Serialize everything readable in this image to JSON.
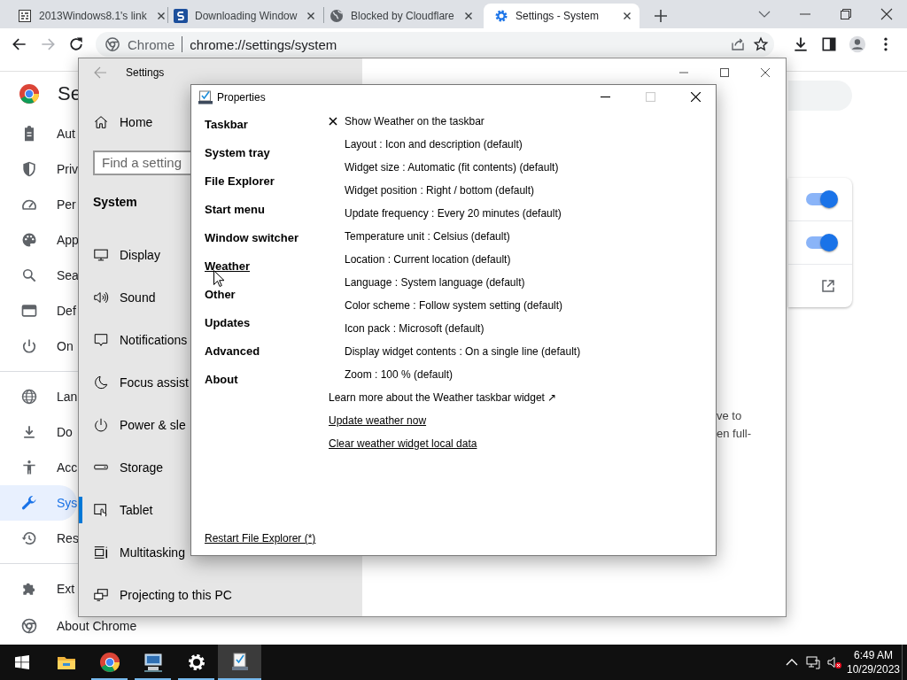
{
  "browser": {
    "tabs": [
      {
        "title": "2013Windows8.1's link",
        "selected": false
      },
      {
        "title": "Downloading Window",
        "selected": false
      },
      {
        "title": "Blocked by Cloudflare",
        "selected": false
      },
      {
        "title": "Settings - System",
        "selected": true
      }
    ],
    "address_bar": {
      "chip": "Chrome",
      "url": "chrome://settings/system"
    }
  },
  "chrome_settings": {
    "heading": "Se",
    "nav_groups": [
      [
        {
          "label": "Aut",
          "selected": false
        },
        {
          "label": "Priv",
          "selected": false
        },
        {
          "label": "Per",
          "selected": false
        },
        {
          "label": "App",
          "selected": false
        },
        {
          "label": "Sea",
          "selected": false
        },
        {
          "label": "Def",
          "selected": false
        },
        {
          "label": "On",
          "selected": false
        }
      ],
      [
        {
          "label": "Lan",
          "selected": false
        },
        {
          "label": "Do",
          "selected": false
        },
        {
          "label": "Acc",
          "selected": false
        },
        {
          "label": "Sys",
          "selected": true
        },
        {
          "label": "Res",
          "selected": false
        }
      ],
      [
        {
          "label": "Ext",
          "selected": false
        },
        {
          "label": "About Chrome",
          "selected": false
        }
      ]
    ],
    "toggles": [
      {
        "on": true
      },
      {
        "on": true
      }
    ]
  },
  "settings_window": {
    "title": "Settings",
    "home": "Home",
    "search": {
      "placeholder": "Find a setting"
    },
    "section": "System",
    "items": [
      {
        "label": "Display",
        "selected": false
      },
      {
        "label": "Sound",
        "selected": false
      },
      {
        "label": "Notifications",
        "selected": false
      },
      {
        "label": "Focus assist",
        "selected": false
      },
      {
        "label": "Power & sle",
        "selected": false
      },
      {
        "label": "Storage",
        "selected": false
      },
      {
        "label": "Tablet",
        "selected": true
      },
      {
        "label": "Multitasking",
        "selected": false
      },
      {
        "label": "Projecting to this PC",
        "selected": false
      }
    ],
    "content_lines": [
      "ve to",
      "en full-"
    ]
  },
  "properties": {
    "title": "Properties",
    "nav": [
      {
        "label": "Taskbar",
        "hovered": false
      },
      {
        "label": "System tray",
        "hovered": false
      },
      {
        "label": "File Explorer",
        "hovered": false
      },
      {
        "label": "Start menu",
        "hovered": false
      },
      {
        "label": "Window switcher",
        "hovered": false
      },
      {
        "label": "Weather",
        "hovered": true
      },
      {
        "label": "Other",
        "hovered": false
      },
      {
        "label": "Updates",
        "hovered": false
      },
      {
        "label": "Advanced",
        "hovered": false
      },
      {
        "label": "About",
        "hovered": false
      }
    ],
    "show_option": {
      "label": "Show Weather on the taskbar",
      "checked": true
    },
    "options": [
      "Layout : Icon and description (default)",
      "Widget size : Automatic (fit contents) (default)",
      "Widget position : Right / bottom (default)",
      "Update frequency : Every 20 minutes (default)",
      "Temperature unit : Celsius (default)",
      "Location : Current location (default)",
      "Language : System language (default)",
      "Color scheme : Follow system setting (default)",
      "Icon pack : Microsoft (default)",
      "Display widget contents : On a single line (default)",
      "Zoom : 100 % (default)"
    ],
    "links": [
      {
        "label": "Learn more about the Weather taskbar widget ↗",
        "underlined": false
      },
      {
        "label": "Update weather now",
        "underlined": true
      },
      {
        "label": "Clear weather widget local data",
        "underlined": true
      }
    ],
    "footer_link": "Restart File Explorer (*)"
  },
  "taskbar": {
    "apps": [
      {
        "running": false,
        "selected": false
      },
      {
        "running": true,
        "selected": false
      },
      {
        "running": true,
        "selected": false
      },
      {
        "running": true,
        "selected": false
      },
      {
        "running": true,
        "selected": true
      }
    ],
    "time": "6:49 AM",
    "date": "10/29/2023"
  }
}
